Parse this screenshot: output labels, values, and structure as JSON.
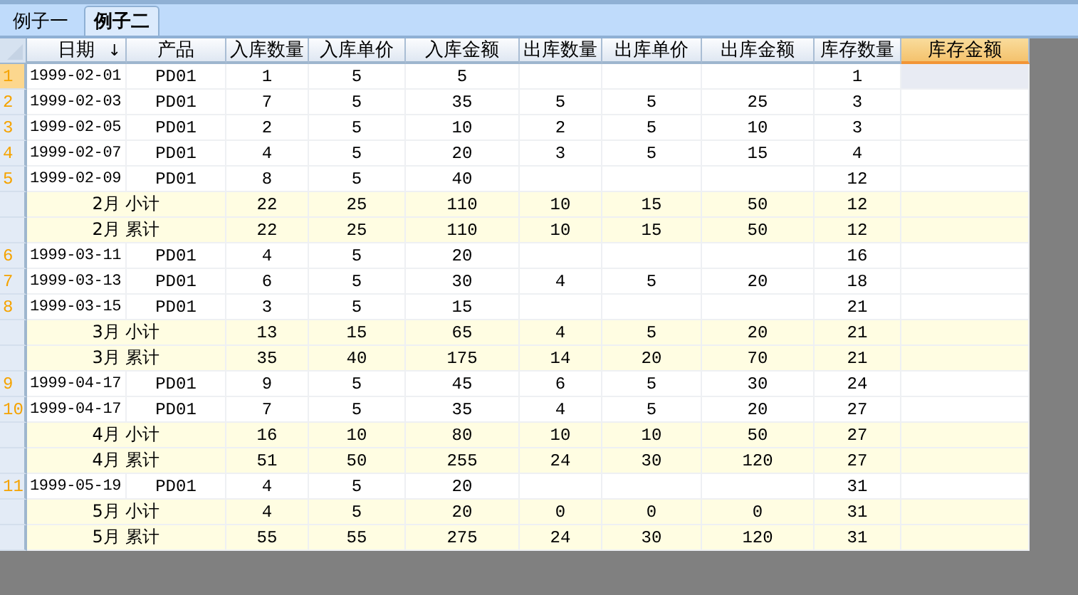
{
  "tabs": [
    {
      "label": "例子一",
      "selected": false
    },
    {
      "label": "例子二",
      "selected": true
    }
  ],
  "table": {
    "columns": [
      {
        "label": "日期",
        "sort_indicator": "↓",
        "selected": false
      },
      {
        "label": "产品",
        "selected": false
      },
      {
        "label": "入库数量",
        "selected": false
      },
      {
        "label": "入库单价",
        "selected": false
      },
      {
        "label": "入库金额",
        "selected": false
      },
      {
        "label": "出库数量",
        "selected": false
      },
      {
        "label": "出库单价",
        "selected": false
      },
      {
        "label": "出库金额",
        "selected": false
      },
      {
        "label": "库存数量",
        "selected": false
      },
      {
        "label": "库存金额",
        "selected": true
      }
    ],
    "rows": [
      {
        "kind": "data",
        "number": "1",
        "selected": true,
        "cells": [
          "1999-02-01",
          "PD01",
          "1",
          "5",
          "5",
          null,
          null,
          null,
          "1",
          null
        ]
      },
      {
        "kind": "data",
        "number": "2",
        "selected": false,
        "cells": [
          "1999-02-03",
          "PD01",
          "7",
          "5",
          "35",
          "5",
          "5",
          "25",
          "3",
          null
        ]
      },
      {
        "kind": "data",
        "number": "3",
        "selected": false,
        "cells": [
          "1999-02-05",
          "PD01",
          "2",
          "5",
          "10",
          "2",
          "5",
          "10",
          "3",
          null
        ]
      },
      {
        "kind": "data",
        "number": "4",
        "selected": false,
        "cells": [
          "1999-02-07",
          "PD01",
          "4",
          "5",
          "20",
          "3",
          "5",
          "15",
          "4",
          null
        ]
      },
      {
        "kind": "data",
        "number": "5",
        "selected": false,
        "cells": [
          "1999-02-09",
          "PD01",
          "8",
          "5",
          "40",
          null,
          null,
          null,
          "12",
          null
        ]
      },
      {
        "kind": "subtotal",
        "label": "2月 小计",
        "selected": false,
        "cells": [
          "22",
          "25",
          "110",
          "10",
          "15",
          "50",
          "12",
          null
        ]
      },
      {
        "kind": "subtotal",
        "label": "2月 累计",
        "selected": false,
        "cells": [
          "22",
          "25",
          "110",
          "10",
          "15",
          "50",
          "12",
          null
        ]
      },
      {
        "kind": "data",
        "number": "6",
        "selected": false,
        "cells": [
          "1999-03-11",
          "PD01",
          "4",
          "5",
          "20",
          null,
          null,
          null,
          "16",
          null
        ]
      },
      {
        "kind": "data",
        "number": "7",
        "selected": false,
        "cells": [
          "1999-03-13",
          "PD01",
          "6",
          "5",
          "30",
          "4",
          "5",
          "20",
          "18",
          null
        ]
      },
      {
        "kind": "data",
        "number": "8",
        "selected": false,
        "cells": [
          "1999-03-15",
          "PD01",
          "3",
          "5",
          "15",
          null,
          null,
          null,
          "21",
          null
        ]
      },
      {
        "kind": "subtotal",
        "label": "3月 小计",
        "selected": false,
        "cells": [
          "13",
          "15",
          "65",
          "4",
          "5",
          "20",
          "21",
          null
        ]
      },
      {
        "kind": "subtotal",
        "label": "3月 累计",
        "selected": false,
        "cells": [
          "35",
          "40",
          "175",
          "14",
          "20",
          "70",
          "21",
          null
        ]
      },
      {
        "kind": "data",
        "number": "9",
        "selected": false,
        "cells": [
          "1999-04-17",
          "PD01",
          "9",
          "5",
          "45",
          "6",
          "5",
          "30",
          "24",
          null
        ]
      },
      {
        "kind": "data",
        "number": "10",
        "selected": false,
        "cells": [
          "1999-04-17",
          "PD01",
          "7",
          "5",
          "35",
          "4",
          "5",
          "20",
          "27",
          null
        ]
      },
      {
        "kind": "subtotal",
        "label": "4月 小计",
        "selected": false,
        "cells": [
          "16",
          "10",
          "80",
          "10",
          "10",
          "50",
          "27",
          null
        ]
      },
      {
        "kind": "subtotal",
        "label": "4月 累计",
        "selected": false,
        "cells": [
          "51",
          "50",
          "255",
          "24",
          "30",
          "120",
          "27",
          null
        ]
      },
      {
        "kind": "data",
        "number": "11",
        "selected": false,
        "cells": [
          "1999-05-19",
          "PD01",
          "4",
          "5",
          "20",
          null,
          null,
          null,
          "31",
          null
        ]
      },
      {
        "kind": "subtotal",
        "label": "5月 小计",
        "selected": false,
        "cells": [
          "4",
          "5",
          "20",
          "0",
          "0",
          "0",
          "31",
          null
        ]
      },
      {
        "kind": "subtotal",
        "label": "5月 累计",
        "selected": false,
        "cells": [
          "55",
          "55",
          "275",
          "24",
          "30",
          "120",
          "31",
          null
        ]
      }
    ]
  }
}
